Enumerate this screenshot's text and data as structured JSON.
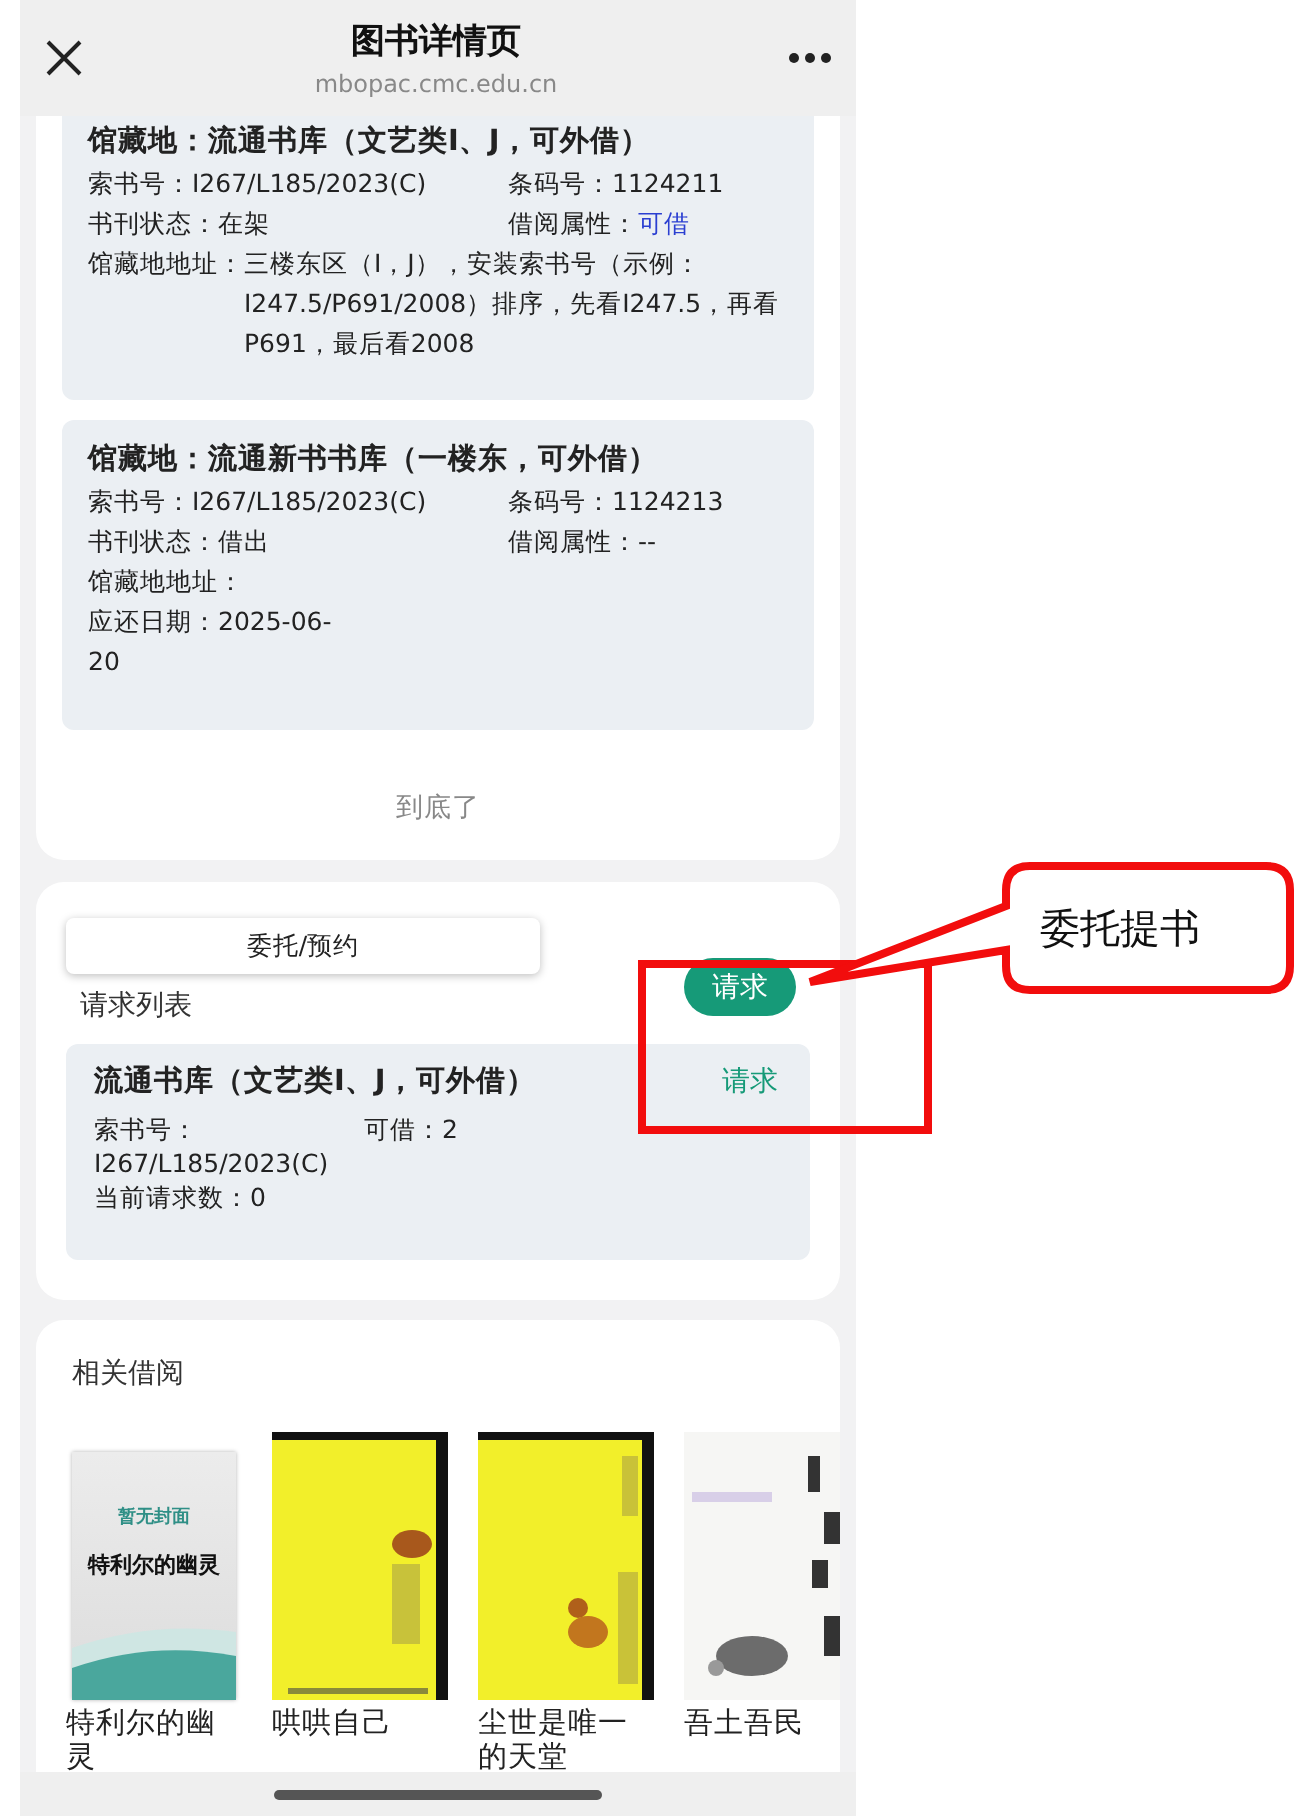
{
  "header": {
    "title": "图书详情页",
    "url": "mbopac.cmc.edu.cn"
  },
  "holdings": [
    {
      "location": "馆藏地：流通书库（文艺类I、J，可外借）",
      "call_no": {
        "label": "索书号：",
        "value": "I267/L185/2023(C)"
      },
      "barcode": {
        "label": "条码号：",
        "value": "1124211"
      },
      "status": {
        "label": "书刊状态：",
        "value": "在架"
      },
      "loan_type": {
        "label": "借阅属性：",
        "value": "可借",
        "available": true
      },
      "address": {
        "label": "馆藏地地址：",
        "value": "三楼东区（I，J），安装索书号（示例：I247.5/P691/2008）排序，先看I247.5，再看P691，最后看2008"
      }
    },
    {
      "location": "馆藏地：流通新书书库（一楼东，可外借）",
      "call_no": {
        "label": "索书号：",
        "value": "I267/L185/2023(C)"
      },
      "barcode": {
        "label": "条码号：",
        "value": "1124213"
      },
      "status": {
        "label": "书刊状态：",
        "value": "借出"
      },
      "loan_type": {
        "label": "借阅属性：",
        "value": "--",
        "available": false
      },
      "address": {
        "label": "馆藏地地址："
      },
      "due_date": {
        "label": "应还日期：",
        "value": "2025-06-20"
      }
    }
  ],
  "end_note": "到底了",
  "request": {
    "tab_button": "委托/预约",
    "list_title": "请求列表",
    "request_button": "请求",
    "items": [
      {
        "location": "流通书库（文艺类I、J，可外借）",
        "action": "请求",
        "call_no_label": "索书号：",
        "call_no": "I267/L185/2023(C)",
        "available": "可借：2",
        "count": "当前请求数：0"
      }
    ]
  },
  "related": {
    "title": "相关借阅",
    "books": [
      {
        "title": "特利尔的幽灵",
        "cover": {
          "kind": "placeholder",
          "note": "暂无封面",
          "title": "特利尔的幽灵"
        }
      },
      {
        "title": "哄哄自己"
      },
      {
        "title": "尘世是唯一的天堂"
      },
      {
        "title": "吾土吾民"
      }
    ]
  },
  "annotation": {
    "callout": "委托提书"
  }
}
